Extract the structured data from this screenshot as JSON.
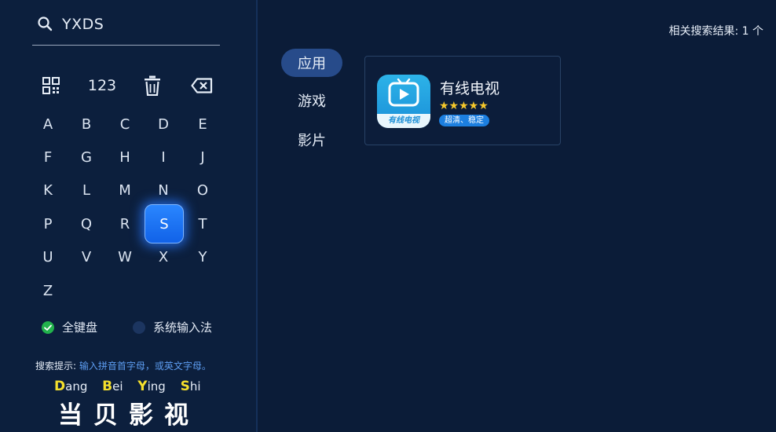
{
  "search": {
    "query": "YXDS"
  },
  "function_row": {
    "numbers_label": "123"
  },
  "keyboard": {
    "rows": [
      [
        "A",
        "B",
        "C",
        "D",
        "E"
      ],
      [
        "F",
        "G",
        "H",
        "I",
        "J"
      ],
      [
        "K",
        "L",
        "M",
        "N",
        "O"
      ],
      [
        "P",
        "Q",
        "R",
        "S",
        "T"
      ],
      [
        "U",
        "V",
        "W",
        "X",
        "Y"
      ],
      [
        "Z"
      ]
    ],
    "focused_key": "S"
  },
  "input_modes": [
    {
      "label": "全键盘",
      "selected": true
    },
    {
      "label": "系统输入法",
      "selected": false
    }
  ],
  "hint": {
    "prefix": "搜索提示:",
    "text": "输入拼音首字母，或英文字母。"
  },
  "brand": {
    "pinyin": [
      {
        "initial": "D",
        "rest": "ang"
      },
      {
        "initial": "B",
        "rest": "ei"
      },
      {
        "initial": "Y",
        "rest": "ing"
      },
      {
        "initial": "S",
        "rest": "hi"
      }
    ],
    "chinese": "当贝影视"
  },
  "results": {
    "count_text": "相关搜索结果: 1 个",
    "tabs": [
      {
        "label": "应用",
        "active": true
      },
      {
        "label": "游戏",
        "active": false
      },
      {
        "label": "影片",
        "active": false
      }
    ],
    "apps": [
      {
        "name": "有线电视",
        "icon_caption": "有线电视",
        "rating": 4.5,
        "stars_text": "★★★★★",
        "tag": "超清、稳定"
      }
    ]
  },
  "colors": {
    "accent": "#1162e8",
    "tab_active": "#274b8a",
    "star": "#f6c82a",
    "selected_radio": "#22b24c"
  }
}
